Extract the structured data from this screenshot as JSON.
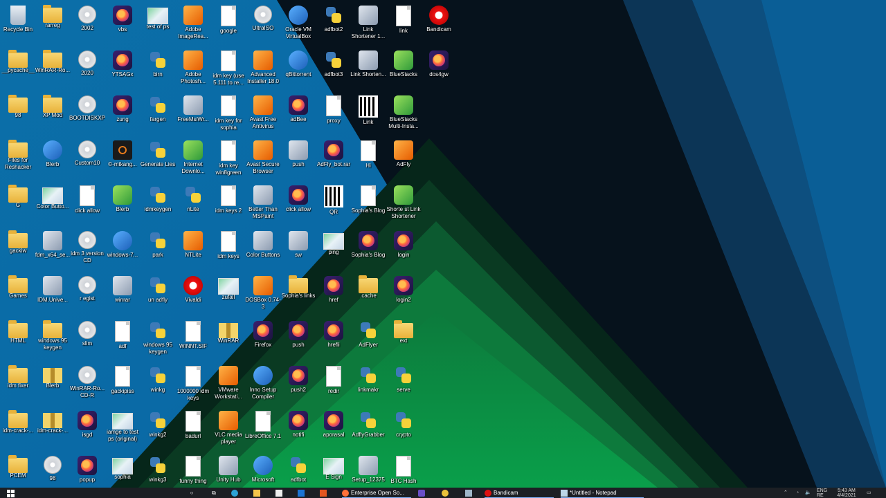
{
  "desktop": {
    "icons": [
      {
        "label": "Recycle Bin",
        "kind": "recycle"
      },
      {
        "label": "rarreg",
        "kind": "folder"
      },
      {
        "label": "2002",
        "kind": "disc"
      },
      {
        "label": "vbs",
        "kind": "firefox"
      },
      {
        "label": "test of ps",
        "kind": "img"
      },
      {
        "label": "Adobe ImageRea...",
        "kind": "orange"
      },
      {
        "label": "google",
        "kind": "file"
      },
      {
        "label": "UltraISO",
        "kind": "disc"
      },
      {
        "label": "Oracle VM VirtualBox",
        "kind": "blue"
      },
      {
        "label": "adfbot2",
        "kind": "python"
      },
      {
        "label": "Link Shortener 1...",
        "kind": "app"
      },
      {
        "label": "link",
        "kind": "file"
      },
      {
        "label": "Bandicam",
        "kind": "red"
      },
      {
        "label": "__pycache__",
        "kind": "folder"
      },
      {
        "label": "WinRAR-Ro...",
        "kind": "folder"
      },
      {
        "label": "2020",
        "kind": "disc"
      },
      {
        "label": "YTSAGx",
        "kind": "firefox"
      },
      {
        "label": "birn",
        "kind": "python"
      },
      {
        "label": "Adobe Photosh...",
        "kind": "orange"
      },
      {
        "label": "idm key (use 5.111 to re...",
        "kind": "file"
      },
      {
        "label": "Advanced Installer 18.0",
        "kind": "orange"
      },
      {
        "label": "qBittorrent",
        "kind": "blue"
      },
      {
        "label": "adfbot3",
        "kind": "python"
      },
      {
        "label": "Link Shorten...",
        "kind": "app"
      },
      {
        "label": "BlueStacks",
        "kind": "green"
      },
      {
        "label": "dos4gw",
        "kind": "firefox"
      },
      {
        "label": "98",
        "kind": "folder"
      },
      {
        "label": "XP Mod",
        "kind": "folder"
      },
      {
        "label": "BOOTDISKXP",
        "kind": "disc"
      },
      {
        "label": "zung",
        "kind": "firefox"
      },
      {
        "label": "fargen",
        "kind": "python"
      },
      {
        "label": "FreeMsiWr...",
        "kind": "app"
      },
      {
        "label": "idm key for sophia",
        "kind": "file"
      },
      {
        "label": "Avast Free Antivirus",
        "kind": "orange"
      },
      {
        "label": "adBee",
        "kind": "firefox"
      },
      {
        "label": "proxy",
        "kind": "file"
      },
      {
        "label": "Link",
        "kind": "qr"
      },
      {
        "label": "BlueStacks Multi-Insta...",
        "kind": "green"
      },
      {
        "label": "Files for Reshacker",
        "kind": "folder"
      },
      {
        "label": "Blerb",
        "kind": "blue"
      },
      {
        "label": "Custom10",
        "kind": "disc"
      },
      {
        "label": "©-mtkang...",
        "kind": "dark"
      },
      {
        "label": "Generate Lies",
        "kind": "python"
      },
      {
        "label": "Internet Downlo...",
        "kind": "green"
      },
      {
        "label": "idm key win8green",
        "kind": "file"
      },
      {
        "label": "Avast Secure Browser",
        "kind": "orange"
      },
      {
        "label": "push",
        "kind": "app"
      },
      {
        "label": "AdFly_bot.rar",
        "kind": "firefox"
      },
      {
        "label": "Hi",
        "kind": "file"
      },
      {
        "label": "AdFly",
        "kind": "orange"
      },
      {
        "label": "G",
        "kind": "folder"
      },
      {
        "label": "Color Butto...",
        "kind": "img"
      },
      {
        "label": "click allow",
        "kind": "file"
      },
      {
        "label": "Blerb",
        "kind": "green"
      },
      {
        "label": "idmkeygen",
        "kind": "python"
      },
      {
        "label": "nLite",
        "kind": "python"
      },
      {
        "label": "idm keys 2",
        "kind": "file"
      },
      {
        "label": "Better Than MSPaint",
        "kind": "app"
      },
      {
        "label": "click allow",
        "kind": "firefox"
      },
      {
        "label": "QR",
        "kind": "qr"
      },
      {
        "label": "Sophia's Blog",
        "kind": "file"
      },
      {
        "label": "Shorte st Link Shortener",
        "kind": "green"
      },
      {
        "label": "gackiw",
        "kind": "folder"
      },
      {
        "label": "fdm_x64_se...",
        "kind": "app"
      },
      {
        "label": "idm 3 version CD",
        "kind": "disc"
      },
      {
        "label": "windows-7...",
        "kind": "blue"
      },
      {
        "label": "park",
        "kind": "python"
      },
      {
        "label": "NTLite",
        "kind": "orange"
      },
      {
        "label": "idm keys",
        "kind": "file"
      },
      {
        "label": "Color Buttons",
        "kind": "app"
      },
      {
        "label": "sw",
        "kind": "app"
      },
      {
        "label": "ping",
        "kind": "img"
      },
      {
        "label": "Sophia's Blog",
        "kind": "firefox"
      },
      {
        "label": "login",
        "kind": "firefox"
      },
      {
        "label": "Games",
        "kind": "folder"
      },
      {
        "label": "IDM.Unive...",
        "kind": "app"
      },
      {
        "label": "r egist",
        "kind": "disc"
      },
      {
        "label": "winrar",
        "kind": "app"
      },
      {
        "label": "un adfly",
        "kind": "python"
      },
      {
        "label": "Vivaldi",
        "kind": "red"
      },
      {
        "label": "zufall",
        "kind": "img"
      },
      {
        "label": "DOSBox 0.74-3",
        "kind": "orange"
      },
      {
        "label": "Sophia's links",
        "kind": "folder"
      },
      {
        "label": "href",
        "kind": "firefox"
      },
      {
        "label": ".cache",
        "kind": "folder"
      },
      {
        "label": "login2",
        "kind": "firefox"
      },
      {
        "label": "HTML",
        "kind": "folder"
      },
      {
        "label": "windows 95 keygen",
        "kind": "folder"
      },
      {
        "label": "slim",
        "kind": "disc"
      },
      {
        "label": "adf",
        "kind": "file"
      },
      {
        "label": "windows 95 keygen",
        "kind": "python"
      },
      {
        "label": "WINNT.SIF",
        "kind": "file"
      },
      {
        "label": "WinRAR",
        "kind": "zip"
      },
      {
        "label": "Firefox",
        "kind": "firefox"
      },
      {
        "label": "push",
        "kind": "firefox"
      },
      {
        "label": "hrefli",
        "kind": "firefox"
      },
      {
        "label": "AdFlyer",
        "kind": "python"
      },
      {
        "label": "ext",
        "kind": "folder"
      },
      {
        "label": "idm fixer",
        "kind": "folder"
      },
      {
        "label": "Blerb",
        "kind": "zip"
      },
      {
        "label": "WinRAR-Ro... CD-R",
        "kind": "disc"
      },
      {
        "label": "gackipiss",
        "kind": "file"
      },
      {
        "label": "winkg",
        "kind": "python"
      },
      {
        "label": "1000000 idm keys",
        "kind": "file"
      },
      {
        "label": "VMware Workstati...",
        "kind": "orange"
      },
      {
        "label": "Inno Setup Compiler",
        "kind": "blue"
      },
      {
        "label": "push2",
        "kind": "firefox"
      },
      {
        "label": "redir",
        "kind": "file"
      },
      {
        "label": "linkmakr",
        "kind": "python"
      },
      {
        "label": "serve",
        "kind": "python"
      },
      {
        "label": "idm-crack-...",
        "kind": "folder"
      },
      {
        "label": "idm-crack-...",
        "kind": "zip"
      },
      {
        "label": "isgd",
        "kind": "firefox"
      },
      {
        "label": "iamge to test ps (original)",
        "kind": "img"
      },
      {
        "label": "winkg2",
        "kind": "python"
      },
      {
        "label": "badurl",
        "kind": "file"
      },
      {
        "label": "VLC media player",
        "kind": "orange"
      },
      {
        "label": "LibreOffice 7.1",
        "kind": "file"
      },
      {
        "label": "notifi",
        "kind": "firefox"
      },
      {
        "label": "aporasal",
        "kind": "firefox"
      },
      {
        "label": "AdflyGrabber",
        "kind": "python"
      },
      {
        "label": "crypto",
        "kind": "python"
      },
      {
        "label": "PCEM",
        "kind": "folder"
      },
      {
        "label": "98",
        "kind": "disc"
      },
      {
        "label": "popup",
        "kind": "firefox"
      },
      {
        "label": "sophia",
        "kind": "img"
      },
      {
        "label": "winkg3",
        "kind": "python"
      },
      {
        "label": "funny thing",
        "kind": "file"
      },
      {
        "label": "Unity Hub",
        "kind": "app"
      },
      {
        "label": "Microsoft",
        "kind": "blue"
      },
      {
        "label": "adfbot",
        "kind": "python"
      },
      {
        "label": "E Sign",
        "kind": "img"
      },
      {
        "label": "Setup_12375",
        "kind": "app"
      },
      {
        "label": "BTC Hash",
        "kind": "file"
      }
    ]
  },
  "taskbar": {
    "search_icon": "search-icon",
    "apps": [
      {
        "name": "taskview-icon"
      },
      {
        "name": "edge-icon"
      },
      {
        "name": "explorer-icon"
      },
      {
        "name": "store-icon"
      },
      {
        "name": "mail-icon"
      },
      {
        "name": "office-icon"
      }
    ],
    "windows": [
      {
        "label": "Enterprise Open So...",
        "icon": "firefox-icon"
      },
      {
        "label": "Bandicam",
        "icon": "bandicam-icon"
      },
      {
        "label": "*Untitled - Notepad",
        "icon": "notepad-icon"
      }
    ],
    "tray": {
      "lang": "ENG",
      "region": "RE",
      "time": "5:43 AM",
      "date": "4/4/2021"
    }
  }
}
